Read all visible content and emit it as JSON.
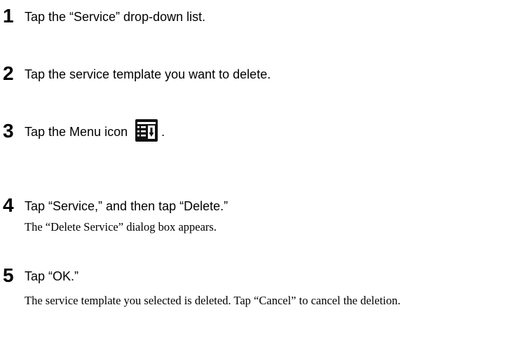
{
  "steps": [
    {
      "number": "1",
      "text": "Tap the “Service” drop-down list."
    },
    {
      "number": "2",
      "text": "Tap the service template you want to delete."
    },
    {
      "number": "3",
      "text_before": "Tap the Menu icon",
      "text_after": ".",
      "icon": "menu-icon"
    },
    {
      "number": "4",
      "text": "Tap “Service,” and then tap “Delete.”",
      "detail": "The “Delete Service” dialog box appears."
    },
    {
      "number": "5",
      "text": "Tap “OK.”",
      "detail": "The service template you selected is deleted. Tap “Cancel” to cancel the deletion."
    }
  ]
}
